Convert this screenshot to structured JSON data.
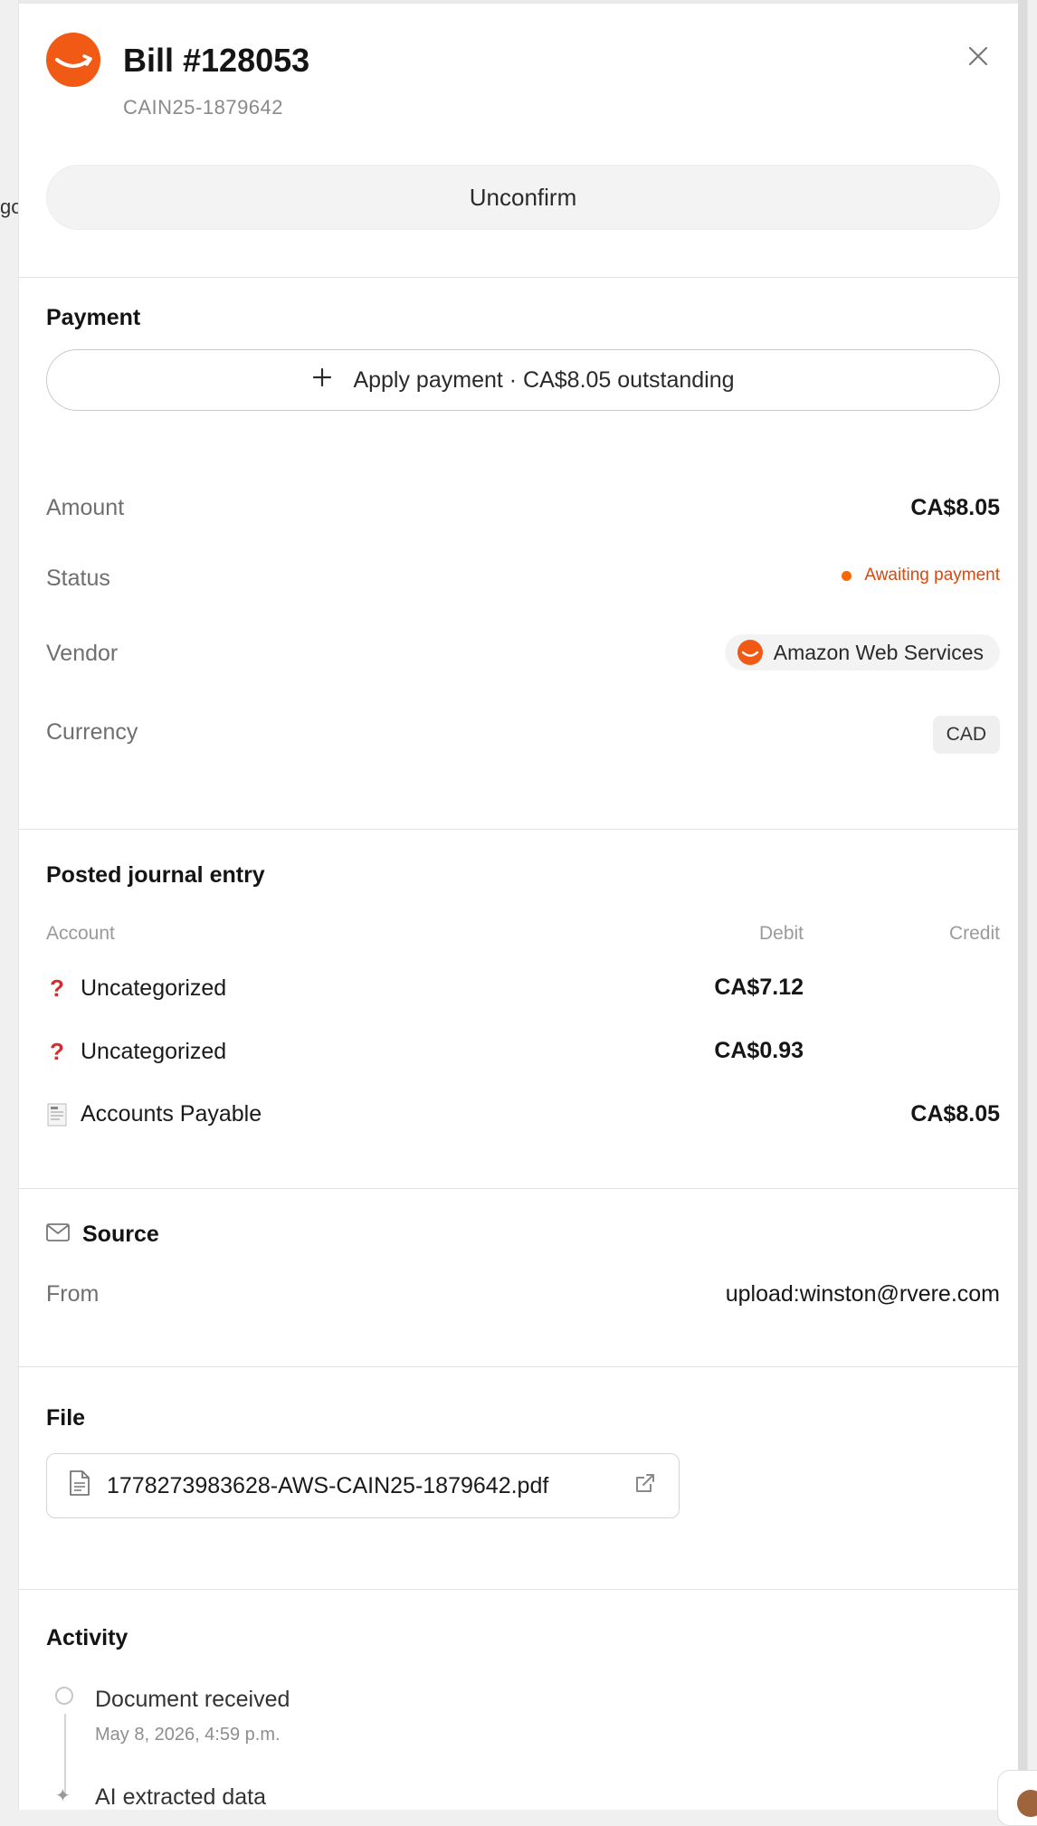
{
  "background": {
    "fragment": "go"
  },
  "header": {
    "title": "Bill #128053",
    "subtitle": "CAIN25-1879642",
    "unconfirm_label": "Unconfirm",
    "logo_icon": "amazon-smile-icon",
    "close_icon": "close-icon"
  },
  "payment": {
    "section_title": "Payment",
    "apply_label": "Apply payment · CA$8.05 outstanding",
    "apply_icon": "plus-icon"
  },
  "details": {
    "amount_label": "Amount",
    "amount_value": "CA$8.05",
    "status_label": "Status",
    "status_value": "Awaiting payment",
    "vendor_label": "Vendor",
    "vendor_value": "Amazon Web Services",
    "currency_label": "Currency",
    "currency_value": "CAD"
  },
  "journal": {
    "section_title": "Posted journal entry",
    "headers": {
      "account": "Account",
      "debit": "Debit",
      "credit": "Credit"
    },
    "rows": [
      {
        "icon": "?",
        "icon_name": "question-icon",
        "account": "Uncategorized",
        "debit": "CA$7.12",
        "credit": ""
      },
      {
        "icon": "?",
        "icon_name": "question-icon",
        "account": "Uncategorized",
        "debit": "CA$0.93",
        "credit": ""
      },
      {
        "icon": "",
        "icon_name": "receipt-icon",
        "account": "Accounts Payable",
        "debit": "",
        "credit": "CA$8.05"
      }
    ]
  },
  "source": {
    "section_title": "Source",
    "from_label": "From",
    "from_value": "upload:winston@rvere.com",
    "icon": "mail-icon"
  },
  "file": {
    "section_title": "File",
    "filename": "1778273983628-AWS-CAIN25-1879642.pdf",
    "doc_icon": "document-icon",
    "open_icon": "external-link-icon"
  },
  "activity": {
    "section_title": "Activity",
    "items": [
      {
        "title": "Document received",
        "time": "May 8, 2026, 4:59 p.m."
      },
      {
        "title": "AI extracted data",
        "time": ""
      }
    ]
  },
  "colors": {
    "brand_orange": "#f05a14",
    "status_orange": "#d9480f",
    "question_red": "#d62b2b"
  }
}
